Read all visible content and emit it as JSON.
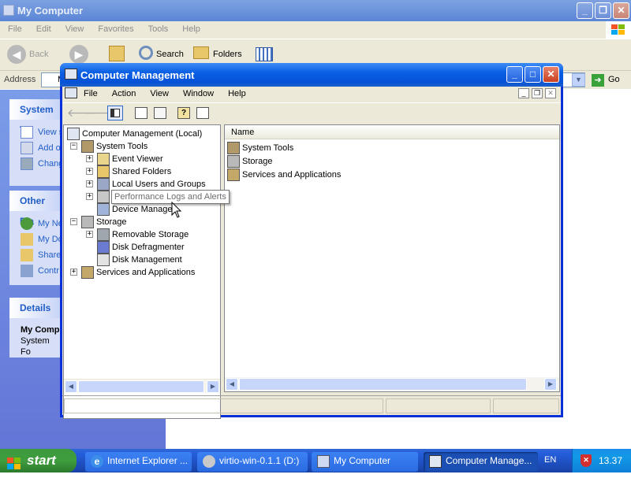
{
  "explorer": {
    "title": "My Computer",
    "menu": [
      "File",
      "Edit",
      "View",
      "Favorites",
      "Tools",
      "Help"
    ],
    "toolbar": {
      "back": "Back",
      "search": "Search",
      "folders": "Folders"
    },
    "address_label": "Address",
    "address_value": "M",
    "go_label": "Go",
    "side_system_title": "System T",
    "side_system_items": [
      "View s",
      "Add o",
      "Chang"
    ],
    "side_other_title": "Other Pla",
    "side_other_items": [
      "My Ne",
      "My Do",
      "Share",
      "Contr"
    ],
    "side_details_title": "Details",
    "details_name": "My Comp",
    "details_desc": "System Fo"
  },
  "mmc": {
    "title": "Computer Management",
    "menu": [
      "File",
      "Action",
      "View",
      "Window",
      "Help"
    ],
    "tree": [
      {
        "label": "Computer Management (Local)",
        "icon": "computer-management-icon"
      },
      {
        "label": "System Tools",
        "icon": "system-tools-icon"
      },
      {
        "label": "Event Viewer",
        "icon": "event-viewer-icon"
      },
      {
        "label": "Shared Folders",
        "icon": "shared-folders-icon"
      },
      {
        "label": "Local Users and Groups",
        "icon": "users-groups-icon"
      },
      {
        "label": "Performance Logs and Alerts",
        "icon": "performance-icon"
      },
      {
        "label": "Device Manager",
        "icon": "device-manager-icon"
      },
      {
        "label": "Storage",
        "icon": "storage-icon"
      },
      {
        "label": "Removable Storage",
        "icon": "removable-storage-icon"
      },
      {
        "label": "Disk Defragmenter",
        "icon": "defrag-icon"
      },
      {
        "label": "Disk Management",
        "icon": "disk-management-icon"
      },
      {
        "label": "Services and Applications",
        "icon": "services-icon"
      }
    ],
    "tooltip": "Performance Logs and Alerts",
    "list_header": "Name",
    "list_items": [
      "System Tools",
      "Storage",
      "Services and Applications"
    ]
  },
  "taskbar": {
    "start": "start",
    "tasks": [
      "Internet Explorer ...",
      "virtio-win-0.1.1 (D:)",
      "My Computer",
      "Computer Manage..."
    ],
    "language": "EN",
    "clock": "13.37"
  },
  "colors": {
    "xp_blue": "#0a5fe3",
    "taskbar": "#245edb",
    "start_green": "#3c9a3c",
    "panel_bg": "#7a9ae8"
  }
}
